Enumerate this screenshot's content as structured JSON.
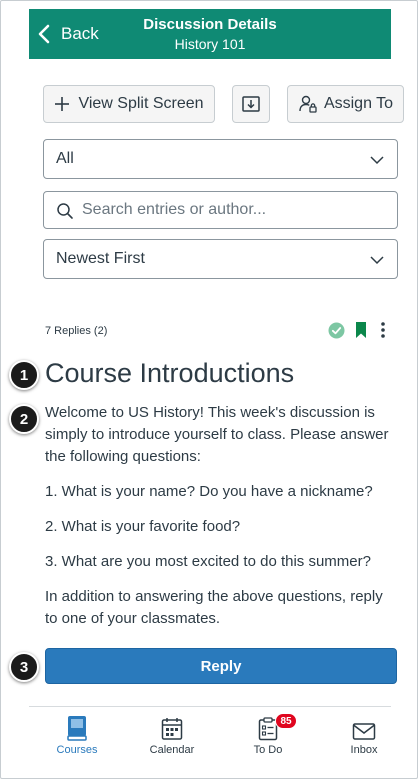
{
  "header": {
    "back_label": "Back",
    "title": "Discussion Details",
    "subtitle": "History 101",
    "background": "#0f8a74"
  },
  "toolbar": {
    "split_screen_label": "View Split Screen",
    "download_icon": "download-icon",
    "assign_label": "Assign To"
  },
  "filter": {
    "selected": "All"
  },
  "search": {
    "placeholder": "Search entries or author..."
  },
  "sort": {
    "selected": "Newest First"
  },
  "discussion": {
    "replies_label": "7 Replies (2)",
    "published_icon": "check-circle-icon",
    "bookmark_icon": "bookmark-icon",
    "title": "Course Introductions",
    "paragraphs": [
      "Welcome to US History! This week's discussion is simply to introduce yourself to class. Please answer the following questions:",
      "1. What is your name? Do you have a nickname?",
      "2. What is your favorite food?",
      "3. What are you most excited to do this summer?",
      "In addition to answering the above questions, reply to one of your classmates."
    ],
    "reply_label": "Reply"
  },
  "markers": [
    "1",
    "2",
    "3"
  ],
  "tabs": [
    {
      "label": "Courses",
      "icon": "courses-icon",
      "active": true
    },
    {
      "label": "Calendar",
      "icon": "calendar-icon",
      "active": false
    },
    {
      "label": "To Do",
      "icon": "todo-icon",
      "active": false,
      "badge": "85"
    },
    {
      "label": "Inbox",
      "icon": "inbox-icon",
      "active": false
    }
  ],
  "colors": {
    "accent": "#2a7abc",
    "success": "#0b874b",
    "badge": "#e0061f"
  }
}
